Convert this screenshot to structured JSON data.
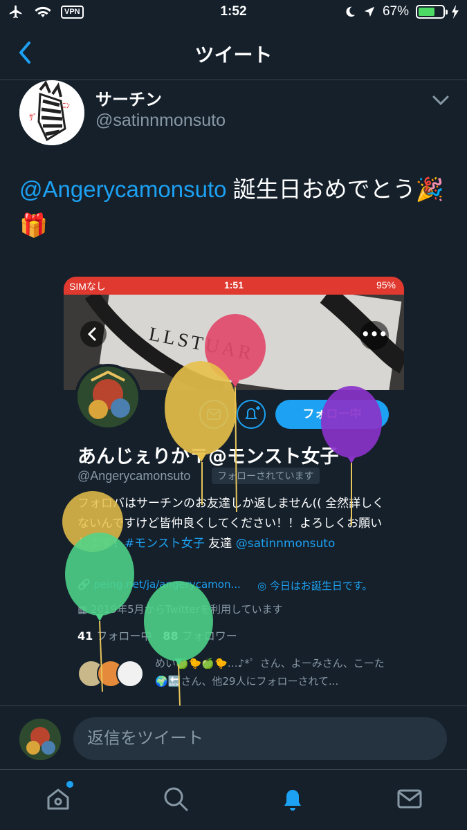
{
  "status_bar": {
    "time": "1:52",
    "vpn": "VPN",
    "battery": "67%",
    "battery_level": 0.67
  },
  "nav": {
    "title": "ツイート"
  },
  "tweet": {
    "display_name": "サーチン",
    "handle": "@satinnmonsuto",
    "mention": "@Angerycamonsuto",
    "text": " 誕生日おめでとう🎉🎁"
  },
  "embedded": {
    "status": {
      "carrier": "SIMなし",
      "time": "1:51",
      "battery": "95%"
    },
    "banner_text": "LLSTUAR",
    "follow_label": "フォロー中",
    "name": "あんじぇりか〒@モンスト女子",
    "handle": "@Angerycamonsuto",
    "follows_you": "フォローされています",
    "bio": "フォロバはサーチンのお友達しか返しません(( 全然詳しくないんですけど皆仲良くしてください！！よろしくお願いします！",
    "hashtag": "#モンスト女子",
    "bio_tail": " 友達 ",
    "bio_mention": "@satinnmonsuto",
    "link": "peing.net/ja/angerycamon...",
    "birthday": "今日はお誕生日です。",
    "joined": "2019年5月からTwitterを利用しています",
    "following_count": "41",
    "following_label": "フォロー中",
    "followers_count": "88",
    "followers_label": "フォロワー",
    "followed_by": "めい🍏🐤🍏🐤…♪*゜さん、よーみさん、こーた🌍🔙さん、他29人にフォローされて..."
  },
  "reply": {
    "placeholder": "返信をツイート"
  },
  "tabs": [
    "home",
    "search",
    "notifications",
    "messages"
  ],
  "colors": {
    "accent": "#1da1f2",
    "background": "#15202b",
    "muted": "#8899a6"
  }
}
